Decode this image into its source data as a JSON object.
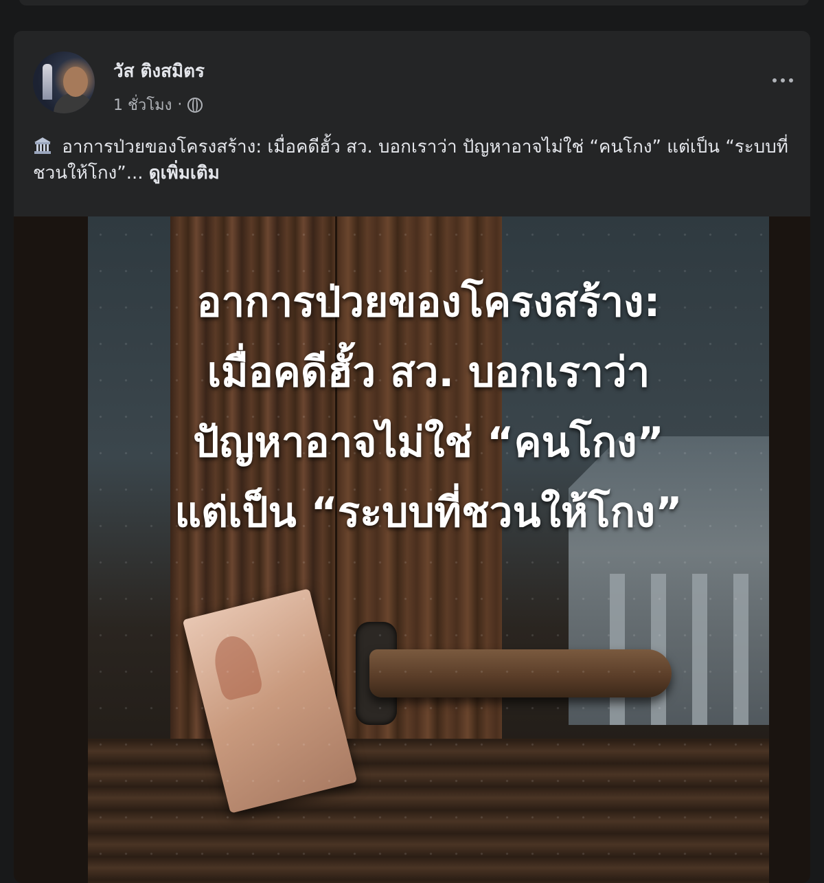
{
  "post": {
    "author": "วัส ติงสมิตร",
    "time": "1 ชั่วโมง",
    "separator": "·",
    "caption_text": "อาการป่วยของโครงสร้าง: เมื่อคดีฮั้ว สว. บอกเราว่า ปัญหาอาจไม่ใช่ “คนโกง” แต่เป็น “ระบบที่ชวนให้โกง”...",
    "see_more": "ดูเพิ่มเติม",
    "icons": {
      "privacy": "globe-icon",
      "caption_emoji": "bank-icon",
      "menu": "more-options-icon"
    }
  },
  "image": {
    "headline_lines": [
      "อาการป่วยของโครงสร้าง:",
      "เมื่อคดีฮั้ว สว. บอกเราว่า",
      "ปัญหาอาจไม่ใช่ “คนโกง”",
      "แต่เป็น “ระบบที่ชวนให้โกง”"
    ]
  }
}
